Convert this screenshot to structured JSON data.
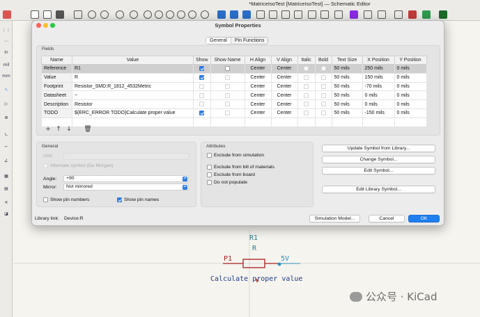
{
  "window": {
    "title": "*MatriceIsoTest [MatriceIsoTest] — Schematic Editor"
  },
  "dialog": {
    "title": "Symbol Properties",
    "tabs": [
      {
        "label": "General",
        "active": true
      },
      {
        "label": "Pin Functions",
        "active": false
      }
    ],
    "fields_section_label": "Fields",
    "columns": [
      "Name",
      "Value",
      "Show",
      "Show Name",
      "H Align",
      "V Align",
      "Italic",
      "Bold",
      "Text Size",
      "X Position",
      "Y Position"
    ],
    "rows": [
      {
        "name": "Reference",
        "value": "R1",
        "show": true,
        "show_name": false,
        "h_align": "Center",
        "v_align": "Center",
        "italic": false,
        "bold": false,
        "text_size": "50 mils",
        "x_position": "250 mils",
        "y_position": "0 mils",
        "selected": true
      },
      {
        "name": "Value",
        "value": "R",
        "show": true,
        "show_name": false,
        "h_align": "Center",
        "v_align": "Center",
        "italic": false,
        "bold": false,
        "text_size": "50 mils",
        "x_position": "150 mils",
        "y_position": "0 mils",
        "selected": false
      },
      {
        "name": "Footprint",
        "value": "Resistor_SMD:R_1812_4532Metric",
        "show": false,
        "show_name": false,
        "h_align": "Center",
        "v_align": "Center",
        "italic": false,
        "bold": false,
        "text_size": "50 mils",
        "x_position": "-70 mils",
        "y_position": "0 mils",
        "selected": false
      },
      {
        "name": "Datasheet",
        "value": "~",
        "show": false,
        "show_name": false,
        "h_align": "Center",
        "v_align": "Center",
        "italic": false,
        "bold": false,
        "text_size": "50 mils",
        "x_position": "0 mils",
        "y_position": "0 mils",
        "selected": false
      },
      {
        "name": "Description",
        "value": "Resistor",
        "show": false,
        "show_name": false,
        "h_align": "Center",
        "v_align": "Center",
        "italic": false,
        "bold": false,
        "text_size": "50 mils",
        "x_position": "0 mils",
        "y_position": "0 mils",
        "selected": false
      },
      {
        "name": "TODO",
        "value": "${ERC_ERROR TODO}Calculate proper value",
        "show": true,
        "show_name": false,
        "h_align": "Center",
        "v_align": "Center",
        "italic": false,
        "bold": false,
        "text_size": "50 mils",
        "x_position": "-150 mils",
        "y_position": "0 mils",
        "selected": false
      }
    ],
    "grid_buttons": [
      "add-icon",
      "move-up-icon",
      "move-down-icon",
      "trash-icon"
    ],
    "general": {
      "label": "General",
      "unit_label": "Unit:",
      "unit_value": "",
      "alternate_symbol_label": "Alternate symbol (De Morgan)",
      "angle_label": "Angle:",
      "angle_value": "+90",
      "mirror_label": "Mirror:",
      "mirror_value": "Not mirrored",
      "show_pin_numbers_label": "Show pin numbers",
      "show_pin_numbers": false,
      "show_pin_names_label": "Show pin names",
      "show_pin_names": true
    },
    "attributes": {
      "label": "Attributes",
      "exclude_sim": "Exclude from simulation",
      "exclude_bom": "Exclude from bill of materials",
      "exclude_board": "Exclude from board",
      "do_not_populate": "Do not populate"
    },
    "actions": {
      "update_symbol": "Update Symbol from Library...",
      "change_symbol": "Change Symbol...",
      "edit_symbol": "Edit Symbol...",
      "edit_library_symbol": "Edit Library Symbol..."
    },
    "library_link_label": "Library link:",
    "library_link_value": "Device:R",
    "simulation_model": "Simulation Model...",
    "cancel": "Cancel",
    "ok": "OK"
  },
  "schematic": {
    "ref": "R1",
    "value": "R",
    "net_left": "P1",
    "net_right": "5V",
    "todo_text": "Calculate proper value"
  },
  "left_toolbar": [
    "in",
    "mil",
    "mm"
  ],
  "watermark": {
    "text": "公众号 · KiCad"
  },
  "colors": {
    "accent": "#1f7ff1",
    "schematic_ref": "#2a7d8f",
    "wire": "#2a8fbf",
    "component": "#a81e1e",
    "text_blue": "#1e3a8a"
  }
}
